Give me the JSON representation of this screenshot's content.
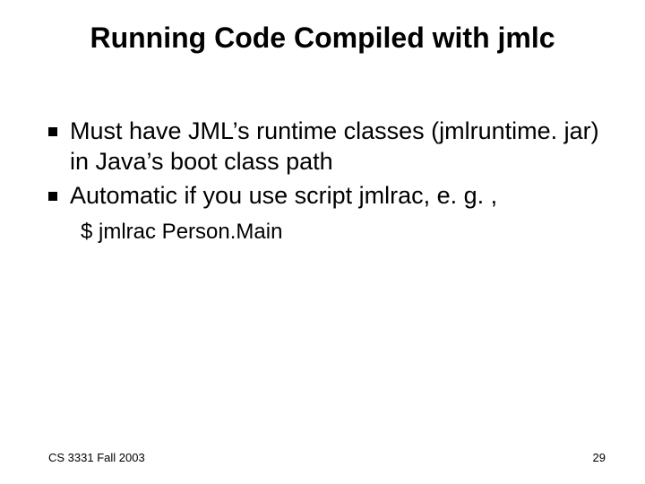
{
  "title": "Running Code Compiled with jmlc",
  "bullets": [
    "Must have JML’s runtime classes (jmlruntime. jar) in Java’s boot class path",
    "Automatic if you use script jmlrac, e. g. ,"
  ],
  "sub_example": "$ jmlrac Person.Main",
  "footer": {
    "left": "CS 3331 Fall 2003",
    "right": "29"
  }
}
